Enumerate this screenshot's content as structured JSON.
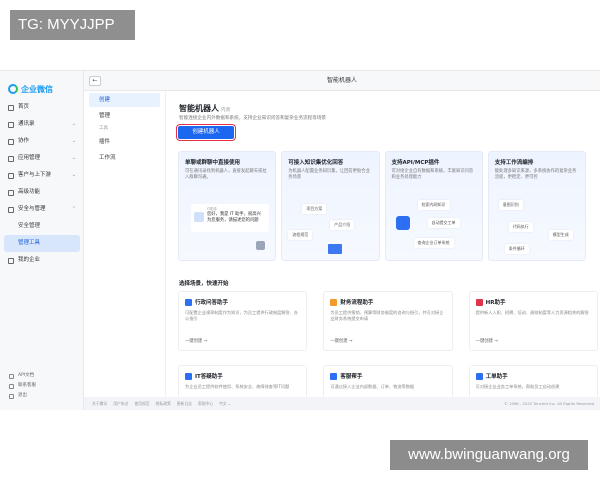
{
  "overlay": {
    "tag": "TG: MYYJJPP",
    "watermark": "www.bwinguanwang.org"
  },
  "app": {
    "brand": "企业微信",
    "window_title": "智能机器人",
    "nav": [
      {
        "label": "首页",
        "icon": "home-icon",
        "chevron": ""
      },
      {
        "label": "通讯录",
        "icon": "contacts-icon",
        "chevron": "⌄"
      },
      {
        "label": "协作",
        "icon": "collab-icon",
        "chevron": "⌄"
      },
      {
        "label": "应用管理",
        "icon": "apps-icon",
        "chevron": "⌄"
      },
      {
        "label": "客户与上下游",
        "icon": "customer-icon",
        "chevron": "⌄"
      },
      {
        "label": "高级功能",
        "icon": "advanced-icon",
        "chevron": ""
      },
      {
        "label": "安全与管理",
        "icon": "shield-icon",
        "chevron": "⌃"
      }
    ],
    "nav_sub": [
      "安全管理",
      "管理工具"
    ],
    "nav_after": {
      "label": "我的企业",
      "icon": "company-icon"
    },
    "side_footer": [
      "API文档",
      "联系客服",
      "退出"
    ],
    "submenu": {
      "items_top": [
        "创建",
        "管理"
      ],
      "group": "工具",
      "items_bottom": [
        "插件",
        "工作流"
      ]
    },
    "main": {
      "title": "智能机器人",
      "version": "内测",
      "desc": "智能连接企业内外数据和系统，支持企业知识问答和复杂业务流程等场景",
      "create_button": "创建机器人",
      "cards": [
        {
          "title": "单聊或群聊中直接使用",
          "desc": "可在通讯录找到机器人，直接发起聊天或拉入群聊沟通。",
          "chat_name": "IT助手",
          "chat_text": "您好，我是 IT 助手，很高兴为您服务，请描述您的问题"
        },
        {
          "title": "可接入知识集优化回答",
          "desc": "为机器人配置业务知识集，让回答更贴合业务场景",
          "chips": [
            "项目方案",
            "产品介绍",
            "流程规范"
          ]
        },
        {
          "title": "支持API/MCP插件",
          "desc": "可对接企业自有数据和系统，丰富知识问答和业务处理能力",
          "chips": [
            "检索内网知识",
            "自动提交工单",
            "查询企业订单系统"
          ]
        },
        {
          "title": "支持工作流编排",
          "desc": "能处理多知识来源，多系统协作的复杂业务流程，更稳定、更可控",
          "chips": [
            "意图识别",
            "代码执行",
            "模型生成",
            "条件循环"
          ]
        }
      ],
      "section_title": "选择场景，快速开始",
      "scenes": [
        {
          "title": "行政问答助手",
          "desc": "可配置企业规章制度作为知识，为员工提供行政制度解答、办公指引",
          "link": "一键创建 →",
          "color": "#2d6ff2",
          "icon": "admin-icon"
        },
        {
          "title": "财务流程助手",
          "desc": "为员工提供报销、预算等财务制度的咨询与指引，并可对接企业财务系统提交申请",
          "link": "一键创建 →",
          "color": "#f29b2d",
          "icon": "finance-icon"
        },
        {
          "title": "HR助手",
          "desc": "提供新人入职、招聘、培训、绩效制度等人力资源相关的解答",
          "link": "一键创建 →",
          "color": "#e0334a",
          "icon": "hr-icon"
        },
        {
          "title": "IT答疑助手",
          "desc": "为企业员工提供软件使用、系统安全、故障排查等IT问题",
          "link": "",
          "color": "#2d6ff2",
          "icon": "it-icon"
        },
        {
          "title": "客服帮手",
          "desc": "可通过接入企业内部数据、订单、物流等数据",
          "link": "",
          "color": "#2d6ff2",
          "icon": "service-icon"
        },
        {
          "title": "工单助手",
          "desc": "可对接企业业务工单系统，帮助员工自动创建",
          "link": "",
          "color": "#2d6ff2",
          "icon": "ticket-icon"
        }
      ]
    },
    "footer": {
      "links": [
        "关于腾讯",
        "用户协议",
        "使用规范",
        "隐私政策",
        "更新日志",
        "帮助中心",
        "中文 ⌄"
      ],
      "copyright": "© 1998 - 2025 Tencent Inc. All Rights Reserved"
    }
  }
}
